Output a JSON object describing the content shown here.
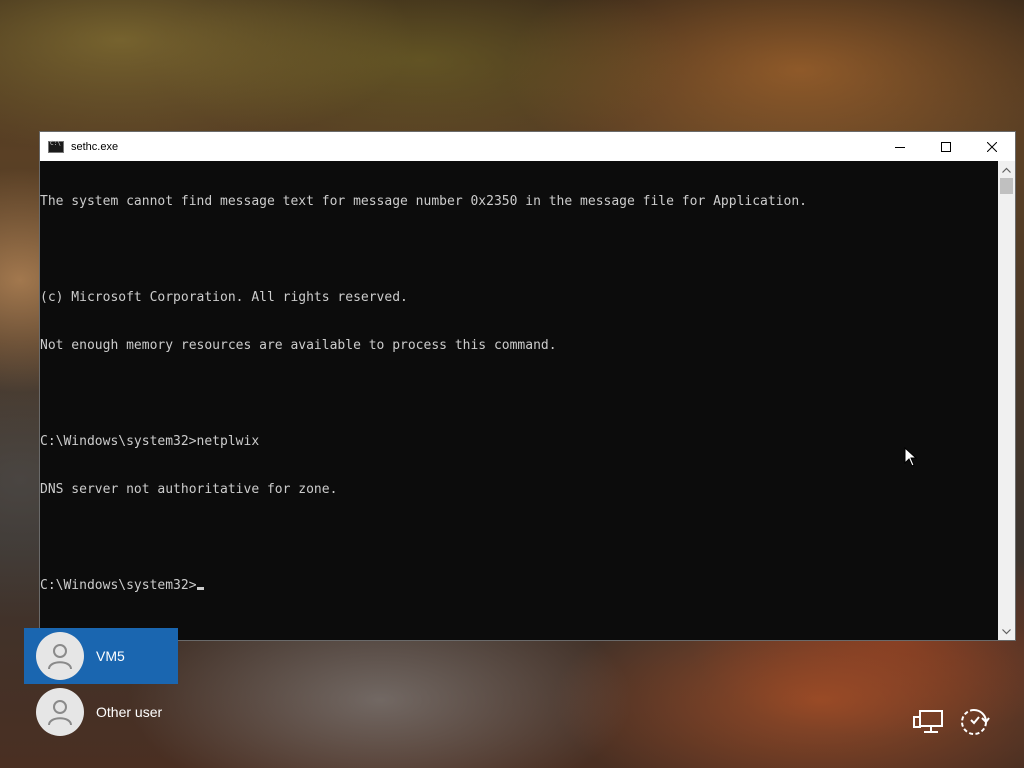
{
  "window": {
    "title": "sethc.exe",
    "icon": "console-icon",
    "controls": [
      "minimize-icon",
      "maximize-icon",
      "close-icon"
    ]
  },
  "console": {
    "lines": [
      "The system cannot find message text for message number 0x2350 in the message file for Application.",
      "",
      "(c) Microsoft Corporation. All rights reserved.",
      "Not enough memory resources are available to process this command.",
      "",
      "C:\\Windows\\system32>netplwix",
      "DNS server not authoritative for zone.",
      ""
    ],
    "prompt": "C:\\Windows\\system32>"
  },
  "users": [
    {
      "name": "VM5",
      "selected": true
    },
    {
      "name": "Other user",
      "selected": false
    }
  ],
  "tray": {
    "network_icon": "network-icon",
    "ease_of_access_icon": "ease-of-access-icon"
  },
  "colors": {
    "console_bg": "#0c0c0c",
    "console_text": "#cccccc",
    "selected_user": "#1a66b0"
  }
}
